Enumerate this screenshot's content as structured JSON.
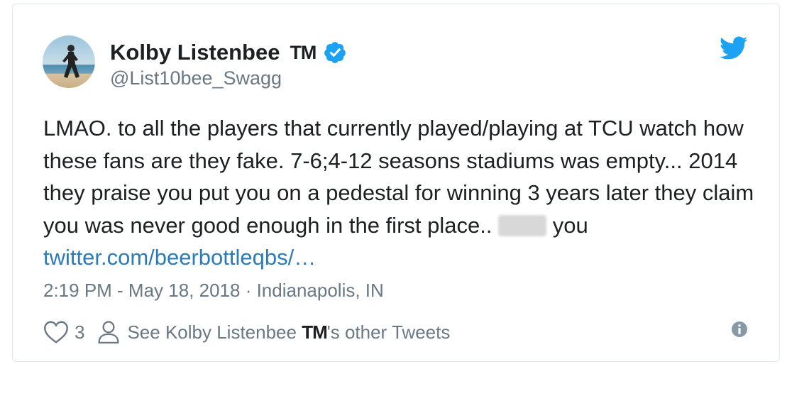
{
  "tweet": {
    "author": {
      "display_name": "Kolby Listenbee",
      "name_suffix": "TM",
      "handle": "@List10bee_Swagg",
      "verified": true,
      "avatar": "runner-on-beach-avatar"
    },
    "text_part1": "LMAO. to all the players that currently played/playing at TCU watch how these fans are they fake. 7-6;4-12 seasons stadiums was empty... 2014 they praise you put you on a pedestal for winning 3 years later they claim you was never good enough in the first place..",
    "text_part2": "you",
    "link_text": "twitter.com/beerbottleqbs/…",
    "timestamp": "2:19 PM - May 18, 2018 · Indianapolis, IN",
    "likes": "3",
    "other_tweets_prefix": "See Kolby Listenbee",
    "other_tweets_tm": "TM",
    "other_tweets_suffix": "'s other Tweets"
  },
  "icons": {
    "brand": "twitter-bird-icon",
    "verified": "verified-badge-icon",
    "like": "heart-icon",
    "profile": "person-icon",
    "info": "info-icon"
  },
  "colors": {
    "text": "#1c2022",
    "muted": "#697882",
    "link": "#2b7bb9",
    "twitter_blue": "#1da1f2",
    "border": "#e1e8ed"
  }
}
